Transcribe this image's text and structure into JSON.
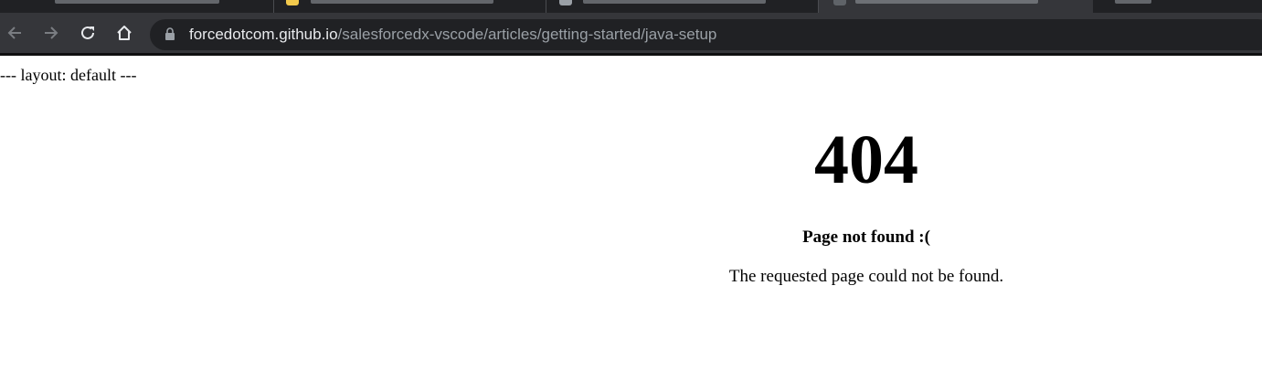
{
  "browser": {
    "url_host": "forcedotcom.github.io",
    "url_path": "/salesforcedx-vscode/articles/getting-started/java-setup"
  },
  "page": {
    "front_matter": "--- layout: default ---",
    "error_code": "404",
    "headline": "Page not found :(",
    "message": "The requested page could not be found."
  },
  "colors": {
    "tabstrip": "#202124",
    "toolbar": "#35363a",
    "omnibox": "#202124",
    "url_host": "#e8eaed",
    "url_path": "#9aa0a6",
    "page_background": "#ffffff"
  },
  "icons": {
    "back": "arrow-left-icon",
    "forward": "arrow-right-icon",
    "reload": "reload-icon",
    "home": "home-icon",
    "lock": "lock-icon"
  }
}
